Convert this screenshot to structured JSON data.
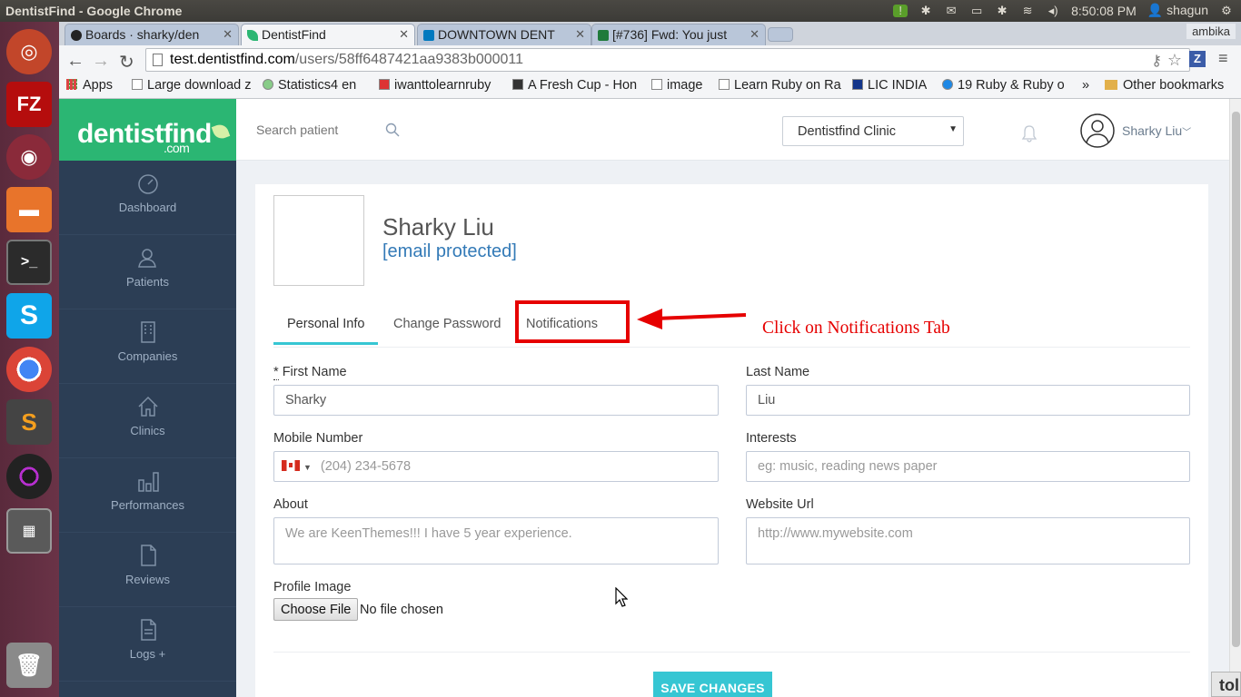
{
  "os": {
    "window_title": "DentistFind - Google Chrome",
    "clock": "8:50:08 PM",
    "user": "shagun"
  },
  "browser": {
    "tabs": [
      {
        "label": "Boards · sharky/den",
        "favicon": "github-icon"
      },
      {
        "label": "DentistFind",
        "favicon": "dentistfind-leaf-icon"
      },
      {
        "label": "DOWNTOWN DENT",
        "favicon": "trello-icon"
      },
      {
        "label": "[#736] Fwd: You just",
        "favicon": "email-icon"
      }
    ],
    "profile": "ambika",
    "url_host": "test.dentistfind.com",
    "url_path": "/users/58ff6487421aa9383b000011",
    "bookmarks": [
      {
        "label": "Apps"
      },
      {
        "label": "Large download ze"
      },
      {
        "label": "Statistics4 en"
      },
      {
        "label": "iwanttolearnruby"
      },
      {
        "label": "A Fresh Cup - Hon"
      },
      {
        "label": "image"
      },
      {
        "label": "Learn Ruby on Ra"
      },
      {
        "label": "LIC INDIA"
      },
      {
        "label": "19 Ruby & Ruby o"
      },
      {
        "label": "»"
      },
      {
        "label": "Other bookmarks"
      }
    ]
  },
  "app": {
    "logo": {
      "main": "dentistfind",
      "sub": ".com"
    },
    "search": {
      "placeholder": "Search patient"
    },
    "clinic_select": {
      "value": "Dentistfind Clinic"
    },
    "user_name": "Sharky Liu",
    "sidebar": {
      "items": [
        {
          "label": "Dashboard",
          "icon": "speedometer-icon"
        },
        {
          "label": "Patients",
          "icon": "users-icon"
        },
        {
          "label": "Companies",
          "icon": "building-icon"
        },
        {
          "label": "Clinics",
          "icon": "home-icon"
        },
        {
          "label": "Performances",
          "icon": "bar-chart-icon"
        },
        {
          "label": "Reviews",
          "icon": "document-icon"
        },
        {
          "label": "Logs +",
          "icon": "logs-icon"
        }
      ]
    },
    "profile": {
      "name": "Sharky Liu",
      "email": "[email protected]",
      "tabs": [
        "Personal Info",
        "Change Password",
        "Notifications"
      ],
      "active_tab": "Personal Info"
    },
    "annotation": {
      "text": "Click on Notifications Tab",
      "color": "#e60000"
    },
    "form": {
      "first_name": {
        "required_mark": "*",
        "label": "First Name",
        "value": "Sharky"
      },
      "last_name": {
        "label": "Last Name",
        "value": "Liu"
      },
      "mobile": {
        "label": "Mobile Number",
        "placeholder": "(204) 234-5678",
        "country": "CA"
      },
      "interests": {
        "label": "Interests",
        "placeholder": "eg: music, reading news paper"
      },
      "about": {
        "label": "About",
        "placeholder": "We are KeenThemes!!! I have 5 year experience."
      },
      "website": {
        "label": "Website Url",
        "placeholder": "http://www.mywebsite.com"
      },
      "profile_image": {
        "label": "Profile Image",
        "button": "Choose File",
        "status": "No file chosen"
      },
      "save_label": "SAVE CHANGES"
    },
    "colors": {
      "brand_green": "#2bb673",
      "sidebar": "#2c3e55",
      "accent": "#36c6d3",
      "link": "#337ab7"
    }
  },
  "corner": {
    "label": "tol"
  }
}
